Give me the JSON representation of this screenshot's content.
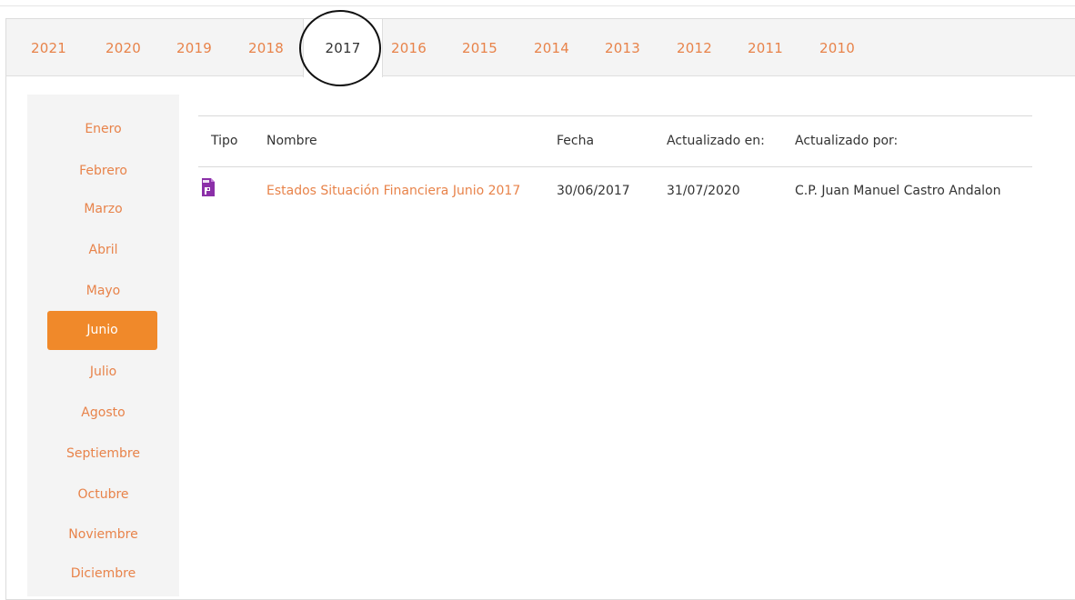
{
  "years": [
    "2021",
    "2020",
    "2019",
    "2018",
    "2017",
    "2016",
    "2015",
    "2014",
    "2013",
    "2012",
    "2011",
    "2010"
  ],
  "selected_year": "2017",
  "months": [
    "Enero",
    "Febrero",
    "Marzo",
    "Abril",
    "Mayo",
    "Junio",
    "Julio",
    "Agosto",
    "Septiembre",
    "Octubre",
    "Noviembre",
    "Diciembre"
  ],
  "selected_month": "Junio",
  "table": {
    "headers": [
      "Tipo",
      "Nombre",
      "Fecha",
      "Actualizado en:",
      "Actualizado por:"
    ],
    "rows": [
      {
        "tipo_icon": "pdf-file-icon",
        "nombre": "Estados Situación Financiera Junio 2017",
        "fecha": "30/06/2017",
        "actualizado_en": "31/07/2020",
        "actualizado_por": "C.P. Juan Manuel Castro Andalon"
      }
    ]
  },
  "colors": {
    "accent": "#e8834a",
    "active_month_bg": "#f0892a",
    "pdf_icon": "#8b2fa8"
  }
}
